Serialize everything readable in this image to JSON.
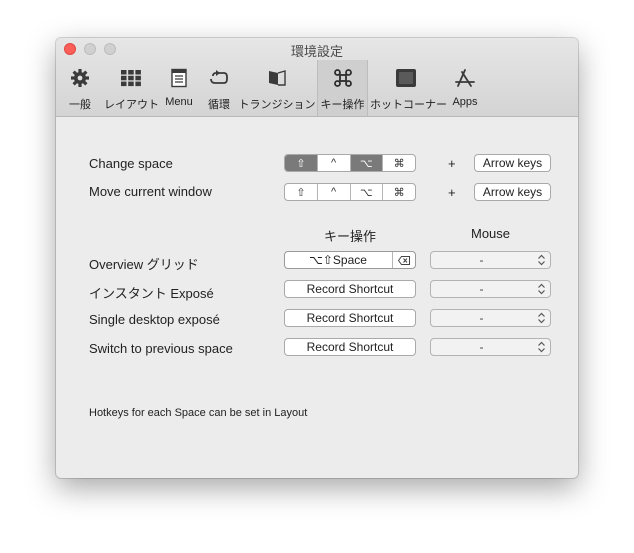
{
  "window": {
    "title": "環境設定"
  },
  "toolbar": {
    "items": [
      {
        "label": "一般",
        "icon": "gear-icon"
      },
      {
        "label": "レイアウト",
        "icon": "grid-icon"
      },
      {
        "label": "Menu",
        "icon": "menu-icon"
      },
      {
        "label": "循環",
        "icon": "cycle-icon"
      },
      {
        "label": "トランジション",
        "icon": "transition-icon"
      },
      {
        "label": "キー操作",
        "icon": "command-key-icon",
        "selected": true
      },
      {
        "label": "ホットコーナー",
        "icon": "hot-corner-icon"
      },
      {
        "label": "Apps",
        "icon": "app-store-icon"
      }
    ]
  },
  "modifiers": {
    "change_space": {
      "label": "Change space",
      "keys": [
        "⇧",
        "^",
        "⌥",
        "⌘"
      ],
      "active": [
        true,
        false,
        true,
        false
      ]
    },
    "move_window": {
      "label": "Move current window",
      "keys": [
        "⇧",
        "^",
        "⌥",
        "⌘"
      ],
      "active": [
        false,
        false,
        false,
        false
      ]
    },
    "plus": "+",
    "arrow_keys_label": "Arrow keys"
  },
  "columns": {
    "keys_header": "キー操作",
    "mouse_header": "Mouse"
  },
  "shortcuts": [
    {
      "label": "Overview グリッド",
      "shortcut": "⌥⇧Space",
      "mouse": "-"
    },
    {
      "label": "インスタント Exposé",
      "shortcut": "Record Shortcut",
      "mouse": "-"
    },
    {
      "label": "Single desktop exposé",
      "shortcut": "Record Shortcut",
      "mouse": "-"
    },
    {
      "label": "Switch to previous space",
      "shortcut": "Record Shortcut",
      "mouse": "-"
    }
  ],
  "footnote": "Hotkeys for each Space can be set in Layout",
  "colors": {
    "close": "#fc5f57",
    "selected_segment": "#7a7a7a",
    "window_bg": "#ececec"
  }
}
